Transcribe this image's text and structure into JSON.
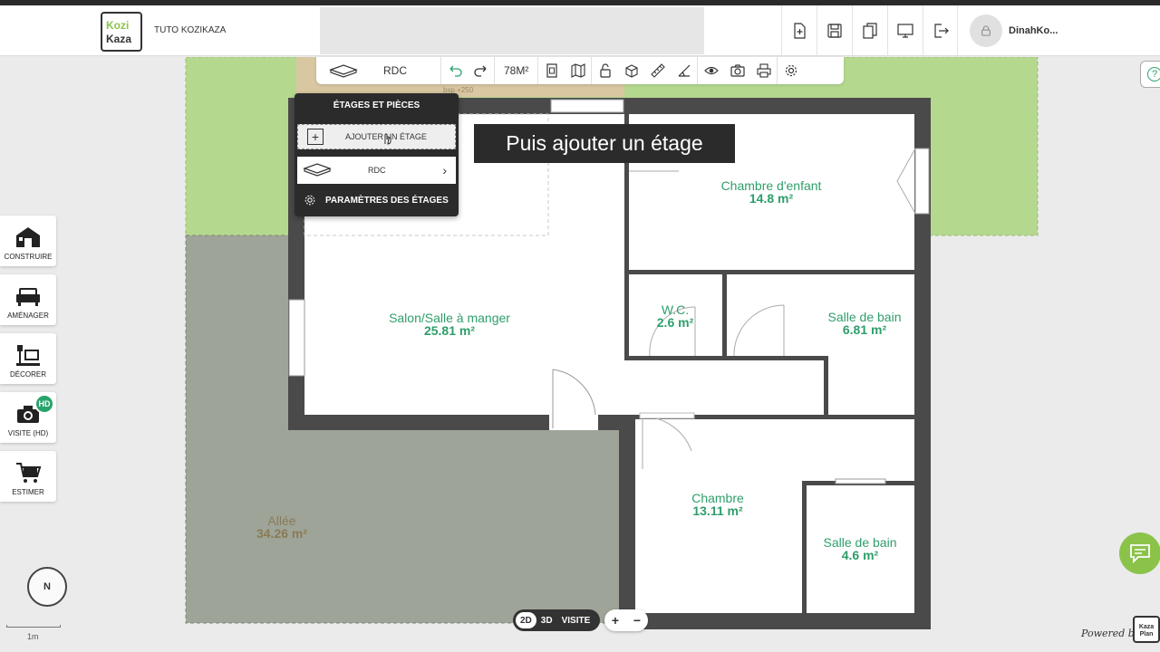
{
  "header": {
    "logo_line1": "Kozi",
    "logo_line2": "Kaza",
    "project_name": "TUTO KOZIKAZA",
    "icons": [
      "new-plan-icon",
      "save-icon",
      "duplicate-icon",
      "screen-icon",
      "logout-icon"
    ],
    "username": "DinahKo..."
  },
  "toolbar": {
    "floor_label": "RDC",
    "area": "78M²",
    "dimension_hint": "bsp +250"
  },
  "dropdown": {
    "title": "ÉTAGES ET PIÈCES",
    "add_floor": "AJOUTER UN ÉTAGE",
    "floor_item": "RDC",
    "settings": "PARAMÈTRES DES ÉTAGES"
  },
  "caption": "Puis ajouter un étage",
  "rooms": [
    {
      "name": "Chambre d'enfant",
      "area": "14.8 m²"
    },
    {
      "name": "Salon/Salle à manger",
      "area": "25.81 m²"
    },
    {
      "name": "W.C.",
      "area": "2.6 m²"
    },
    {
      "name": "Salle de bain",
      "area": "6.81 m²"
    },
    {
      "name": "Chambre",
      "area": "13.11 m²"
    },
    {
      "name": "Salle de bain",
      "area": "4.6 m²"
    },
    {
      "name": "Allée",
      "area": "34.26 m²"
    }
  ],
  "sidebar": [
    {
      "label": "CONSTRUIRE",
      "icon": "house-icon"
    },
    {
      "label": "AMÉNAGER",
      "icon": "sofa-icon"
    },
    {
      "label": "DÉCORER",
      "icon": "lamp-icon"
    },
    {
      "label": "VISITE (HD)",
      "icon": "camera-icon"
    },
    {
      "label": "ESTIMER",
      "icon": "cart-icon"
    }
  ],
  "hd_badge": "HD",
  "compass": "N",
  "scale": "1m",
  "view_modes": [
    "2D",
    "3D",
    "VISITE"
  ],
  "zoom": {
    "plus": "+",
    "minus": "−"
  },
  "help": "?",
  "powered_by": "Powered by",
  "powered_logo": "Kaza Plan",
  "colors": {
    "accent": "#27a36b",
    "brand_green": "#8bc34a",
    "wall": "#4a4a4a",
    "lawn": "#b5d88f",
    "paving": "#9ea598"
  }
}
